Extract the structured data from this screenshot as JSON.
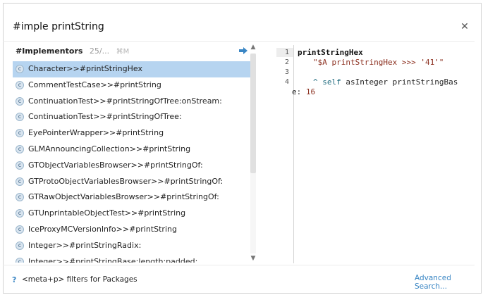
{
  "search": {
    "value": "#imple printString"
  },
  "list": {
    "title": "#Implementors",
    "count": "25/...",
    "shortcut": "⌘M",
    "items": [
      {
        "icon": "c",
        "label": "Character>>#printStringHex",
        "selected": true
      },
      {
        "icon": "c",
        "label": "CommentTestCase>>#printString",
        "selected": false
      },
      {
        "icon": "c",
        "label": "ContinuationTest>>#printStringOfTree:onStream:",
        "selected": false
      },
      {
        "icon": "c",
        "label": "ContinuationTest>>#printStringOfTree:",
        "selected": false
      },
      {
        "icon": "c",
        "label": "EyePointerWrapper>>#printString",
        "selected": false
      },
      {
        "icon": "c",
        "label": "GLMAnnouncingCollection>>#printString",
        "selected": false
      },
      {
        "icon": "c",
        "label": "GTObjectVariablesBrowser>>#printStringOf:",
        "selected": false
      },
      {
        "icon": "c",
        "label": "GTProtoObjectVariablesBrowser>>#printStringOf:",
        "selected": false
      },
      {
        "icon": "c",
        "label": "GTRawObjectVariablesBrowser>>#printStringOf:",
        "selected": false
      },
      {
        "icon": "c",
        "label": "GTUnprintableObjectTest>>#printString",
        "selected": false
      },
      {
        "icon": "c",
        "label": "IceProxyMCVersionInfo>>#printString",
        "selected": false
      },
      {
        "icon": "c",
        "label": "Integer>>#printStringRadix:",
        "selected": false
      },
      {
        "icon": "c",
        "label": "Integer>>#printStringBase:length:padded:",
        "selected": false
      }
    ]
  },
  "code": {
    "line_numbers": [
      "1",
      "2",
      "3",
      "4"
    ],
    "lines": {
      "l1": "printStringHex",
      "l2_string": "\"$A printStringHex >>> '41'\"",
      "l4_caret": "^",
      "l4_self": "self",
      "l4_rest": " asInteger printStringBas",
      "l5_prefix": "e: ",
      "l5_number": "16"
    }
  },
  "footer": {
    "help_icon": "?",
    "help_text": "<meta+p> filters for Packages",
    "advanced_link": "Advanced Search..."
  },
  "colors": {
    "selection": "#b6d4f0",
    "link": "#3a86c4",
    "keyword": "#1d6a7d",
    "string": "#8b2f1f"
  }
}
